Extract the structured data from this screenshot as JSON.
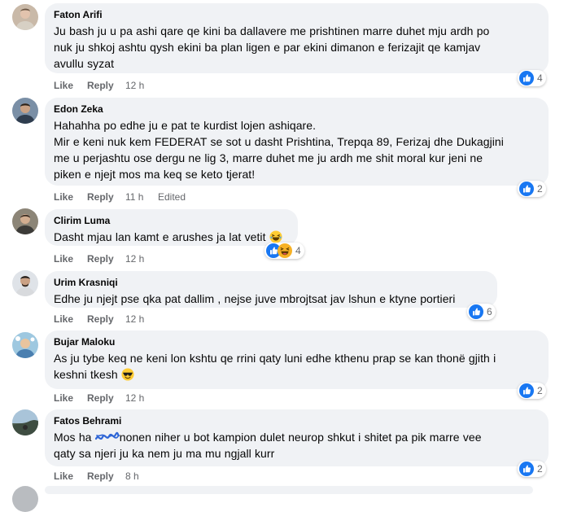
{
  "colors": {
    "bubble_bg": "#f0f2f5",
    "meta_text": "#65676b",
    "like_blue": "#1877f2",
    "haha_yellow": "#f7b125"
  },
  "comments": [
    {
      "author": "Faton Arifi",
      "lines": [
        "Ju bash ju u pa ashi qare qe kini ba dallavere me prishtinen marre duhet mju ardh po",
        "nuk ju shkoj ashtu qysh ekini ba plan ligen e par ekini dimanon e ferizajit qe kamjav",
        "avullu syzat"
      ],
      "like": "Like",
      "reply": "Reply",
      "time": "12 h",
      "reactions": [
        "like-icon"
      ],
      "reaction_count": "4"
    },
    {
      "author": "Edon Zeka",
      "lines": [
        "Hahahha po edhe ju e pat te kurdist lojen ashiqare.",
        "Mir e keni nuk kem FEDERAT se sot u dasht Prishtina, Trepqa 89, Ferizaj dhe Dukagjini",
        "me u perjashtu ose dergu ne lig 3, marre duhet me ju ardh me shit moral kur jeni ne",
        "piken e njejt mos ma keq se keto tjerat!"
      ],
      "like": "Like",
      "reply": "Reply",
      "time": "11 h",
      "edited": "Edited",
      "reactions": [
        "like-icon"
      ],
      "reaction_count": "2"
    },
    {
      "author": "Clirim Luma",
      "lines": [
        "Dasht mjau lan kamt e arushes ja lat vetit"
      ],
      "emoji": "laughing-emoji",
      "like": "Like",
      "reply": "Reply",
      "time": "12 h",
      "reactions": [
        "like-icon",
        "haha-icon"
      ],
      "reaction_count": "4"
    },
    {
      "author": "Urim Krasniqi",
      "lines": [
        "Edhe ju njejt pse qka pat dallim , nejse juve mbrojtsat jav lshun e ktyne portieri"
      ],
      "like": "Like",
      "reply": "Reply",
      "time": "12 h",
      "reactions": [
        "like-icon"
      ],
      "reaction_count": "6"
    },
    {
      "author": "Bujar Maloku",
      "lines": [
        "As ju tybe keq ne keni lon kshtu qe rrini qaty luni edhe kthenu prap se kan thonë gjith i",
        "keshni tkesh"
      ],
      "emoji": "sunglasses-emoji",
      "like": "Like",
      "reply": "Reply",
      "time": "12 h",
      "reactions": [
        "like-icon"
      ],
      "reaction_count": "2"
    },
    {
      "author": "Fatos Behrami",
      "line1_start": "Mos ha",
      "line1_end": "nonen niher u bot kampion dulet neurop shkut i shitet pa pik marre vee",
      "line2": "qaty sa njeri ju ka nem ju ma mu ngjall kurr",
      "like": "Like",
      "reply": "Reply",
      "time": "8 h",
      "reactions": [
        "like-icon"
      ],
      "reaction_count": "2"
    }
  ]
}
